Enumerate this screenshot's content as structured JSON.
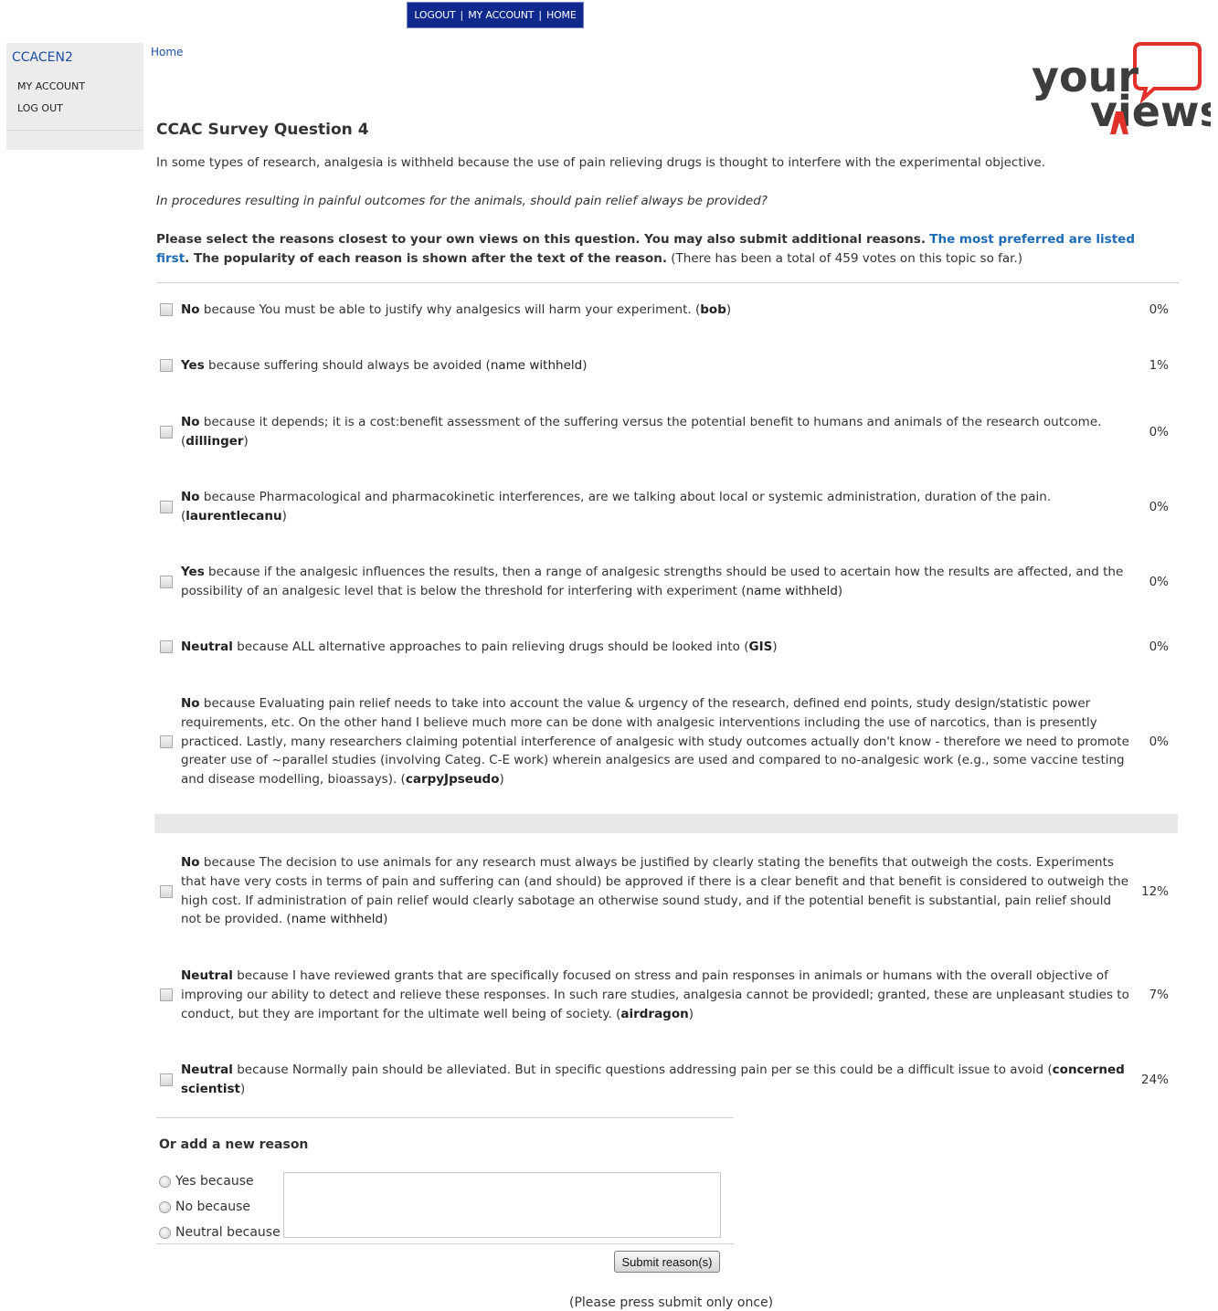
{
  "top_nav": {
    "logout": "LOGOUT",
    "my_account": "MY ACCOUNT",
    "home": "HOME",
    "separator": "|"
  },
  "sidebar": {
    "username": "CCACEN2",
    "my_account": "MY ACCOUNT",
    "log_out": "LOG OUT"
  },
  "breadcrumb": "Home",
  "logo": {
    "word1": "your",
    "word2": "views"
  },
  "page": {
    "title": "CCAC Survey Question 4",
    "intro": "In some types of research, analgesia is withheld because the use of pain relieving drugs is thought to interfere with the experimental objective.",
    "question": "In procedures resulting in painful outcomes for the animals, should pain relief always be provided?",
    "instructions_bold": "Please select the reasons closest to your own views on this question. You may also submit additional reasons.",
    "instructions_highlight": "The most preferred are listed first",
    "instructions_bold2": ". The popularity of each reason is shown after the text of the reason.",
    "instructions_normal": "(There has been a total of 459 votes on this topic so far.)"
  },
  "reasons": [
    {
      "stance": "No",
      "text": "because You must be able to justify why analgesics will harm your experiment. (",
      "author": "bob",
      "close": ")",
      "percent": "0%"
    },
    {
      "stance": "Yes",
      "text": "because suffering should always be avoided (",
      "author": "name withheld",
      "close": ")",
      "percent": "1%"
    },
    {
      "stance": "No",
      "text": "because it depends; it is a cost:benefit assessment of the suffering versus the potential benefit to humans and animals of the research outcome. (",
      "author": "dillinger",
      "close": ")",
      "percent": "0%"
    },
    {
      "stance": "No",
      "text": "because Pharmacological and pharmacokinetic interferences, are we talking about local or systemic administration, duration of the pain. (",
      "author": "laurentlecanu",
      "close": ")",
      "percent": "0%"
    },
    {
      "stance": "Yes",
      "text": "because if the analgesic influences the results, then a range of analgesic strengths should be used to acertain how the results are affected, and the possibility of an analgesic level that is below the threshold for interfering with experiment (",
      "author": "name withheld",
      "close": ")",
      "percent": "0%"
    },
    {
      "stance": "Neutral",
      "text": "because ALL alternative approaches to pain relieving drugs should be looked into (",
      "author": "GIS",
      "close": ")",
      "percent": "0%"
    },
    {
      "stance": "No",
      "text": "because Evaluating pain relief needs to take into account the value & urgency of the research, defined end points, study design/statistic power requirements, etc. On the other hand I believe much more can be done with analgesic interventions including the use of narcotics, than is presently practiced. Lastly, many researchers claiming potential interference of analgesic with study outcomes actually don't know - therefore we need to promote greater use of ~parallel studies (involving Categ. C-E work) wherein analgesics are used and compared to no-analgesic work (e.g., some vaccine testing and disease modelling, bioassays). (",
      "author": "carpyJpseudo",
      "close": ")",
      "percent": "0%"
    },
    {
      "stance": "No",
      "text": "because The decision to use animals for any research must always be justified by clearly stating the benefits that outweigh the costs. Experiments that have very costs in terms of pain and suffering can (and should) be approved if there is a clear benefit and that benefit is considered to outweigh the high cost. If administration of pain relief would clearly sabotage an otherwise sound study, and if the potential benefit is substantial, pain relief should not be provided. (",
      "author": "name withheld",
      "close": ")",
      "percent": "12%"
    },
    {
      "stance": "Neutral",
      "text": "because I have reviewed grants that are specifically focused on stress and pain responses in animals or humans with the overall objective of improving our ability to detect and relieve these responses. In such rare studies, analgesia cannot be providedl; granted, these are unpleasant studies to conduct, but they are important for the ultimate well being of society. (",
      "author": "airdragon",
      "close": ")",
      "percent": "7%"
    },
    {
      "stance": "Neutral",
      "text": "because Normally pain should be alleviated. But in specific questions addressing pain per se this could be a difficult issue to avoid (",
      "author": "concerned scientist",
      "close": ")",
      "percent": "24%"
    }
  ],
  "new_reason": {
    "heading": "Or add a new reason",
    "options": [
      "Yes because",
      "No because",
      "Neutral because"
    ],
    "textarea_value": "",
    "submit_label": "Submit reason(s)",
    "submit_note": "(Please press submit only once)"
  },
  "colors": {
    "nav_bg": "#0f2a8c",
    "link_blue": "#1d4fa3",
    "highlight_blue": "#1d6bb5",
    "logo_dark": "#3d3d3d",
    "logo_red": "#e0312b",
    "sidebar_bg": "#ececec"
  }
}
